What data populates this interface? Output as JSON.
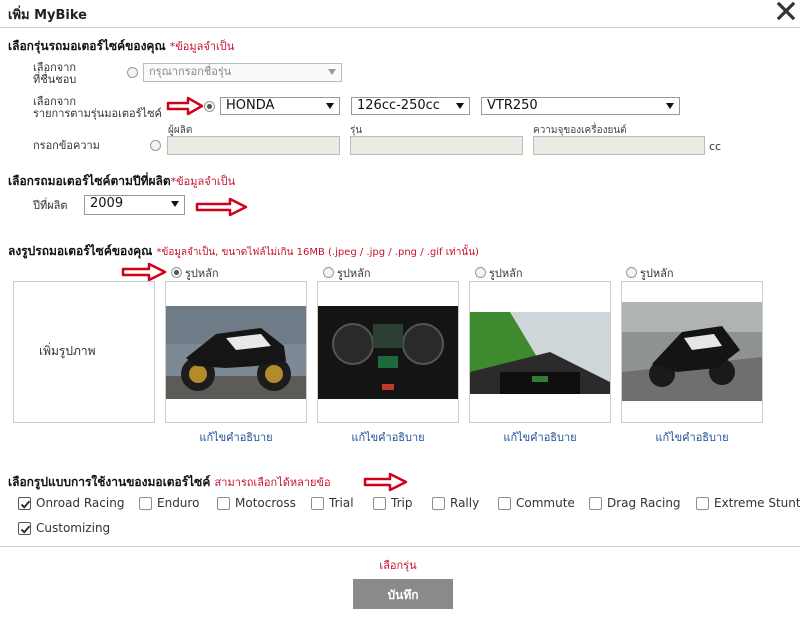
{
  "dialog": {
    "title": "เพิ่ม MyBike"
  },
  "model_section": {
    "heading": "เลือกรุ่นรถมอเตอร์ไซค์ของคุณ",
    "required": "*ข้อมูลจำเป็น",
    "favorite_label_1": "เลือกจาก",
    "favorite_label_2": "ที่ชื่นชอบ",
    "favorite_placeholder": "กรุณากรอกชื่อรุ่น",
    "list_label_1": "เลือกจาก",
    "list_label_2": "รายการตามรุ่นมอเตอร์ไซค์",
    "brand": "HONDA",
    "cc_range": "126cc-250cc",
    "model": "VTR250",
    "manual_label": "กรอกข้อความ",
    "maker_label": "ผู้ผลิต",
    "model_label": "รุ่น",
    "capacity_label": "ความจุของเครื่องยนต์",
    "cc_unit": "cc"
  },
  "year_section": {
    "heading": "เลือกรถมอเตอร์ไซค์ตามปีที่ผลิต",
    "required": "*ข้อมูลจำเป็น",
    "year_label": "ปีที่ผลิต",
    "year": "2009"
  },
  "photo_section": {
    "heading": "ลงรูปรถมอเตอร์ไซค์ของคุณ",
    "note": "*ข้อมูลจำเป็น, ขนาดไฟล์ไม่เกิน 16MB (.jpeg / .jpg / .png / .gif เท่านั้น)",
    "add_photo": "เพิ่มรูปภาพ",
    "main_label": "รูปหลัก",
    "edit_caption": "แก้ไขคำอธิบาย"
  },
  "usage_section": {
    "heading": "เลือกรูปแบบการใช้งานของมอเตอร์ไซค์",
    "note": "สามารถเลือกได้หลายข้อ",
    "options": [
      {
        "label": "Onroad Racing",
        "checked": true
      },
      {
        "label": "Enduro",
        "checked": false
      },
      {
        "label": "Motocross",
        "checked": false
      },
      {
        "label": "Trial",
        "checked": false
      },
      {
        "label": "Trip",
        "checked": false
      },
      {
        "label": "Rally",
        "checked": false
      },
      {
        "label": "Commute",
        "checked": false
      },
      {
        "label": "Drag Racing",
        "checked": false
      },
      {
        "label": "Extreme Stunt",
        "checked": false
      },
      {
        "label": "Customizing",
        "checked": true
      }
    ]
  },
  "footer": {
    "error": "เลือกรุ่น",
    "save": "บันทึก"
  },
  "colors": {
    "required": "#c8102e",
    "link": "#1d4f91",
    "arrow": "#d0021b",
    "button": "#8a8a8a"
  }
}
